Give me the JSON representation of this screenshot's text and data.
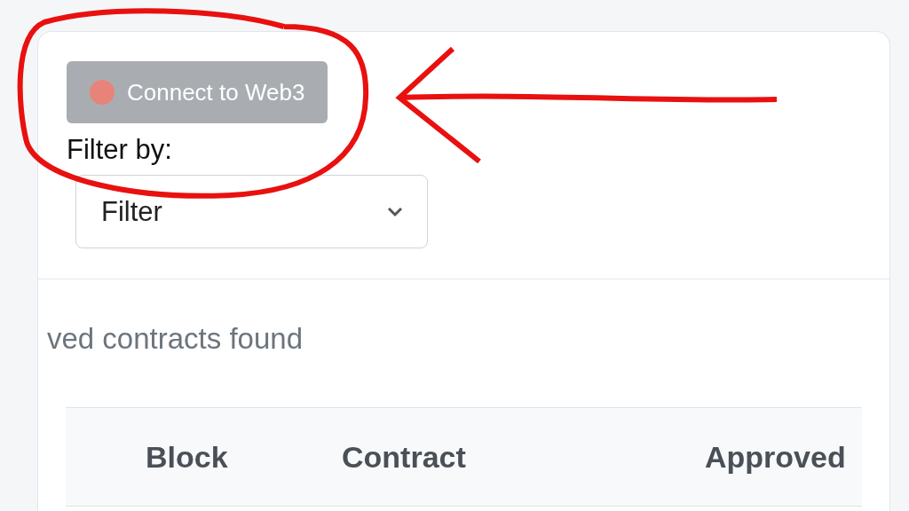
{
  "connect_button": {
    "label": "Connect to Web3",
    "connected": false
  },
  "filter": {
    "label": "Filter by:",
    "value": "Filter"
  },
  "results_message": "ved contracts found",
  "table": {
    "columns": [
      "Block",
      "Contract",
      "Approved"
    ]
  }
}
